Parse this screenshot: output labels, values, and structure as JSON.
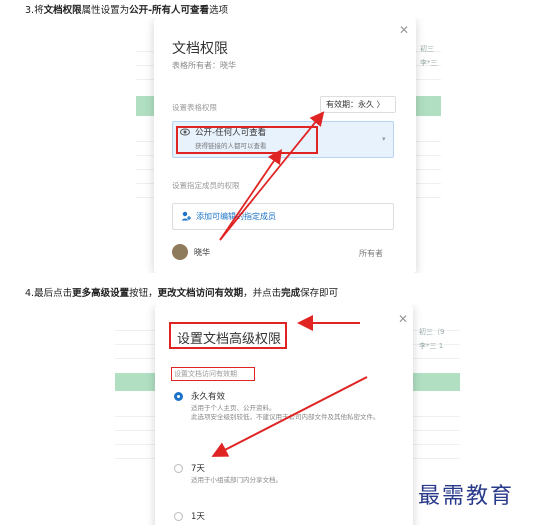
{
  "step3": {
    "prefix": "3.将",
    "bold1": "文档权限",
    "mid": "属性设置为",
    "bold2": "公开-所有人可查看",
    "suffix": "选项"
  },
  "dialog1": {
    "title": "文档权限",
    "owner_line": "表格所有者：晓华",
    "perm_label": "设置表格权限",
    "validity": "有效期：永久 〉",
    "option_main": "公开-任何人可查看",
    "option_sub": "获得链接的人都可以查看",
    "member_label": "设置指定成员的权限",
    "add_member": "添加可编辑的指定成员",
    "owner_name": "晓华",
    "owner_role": "所有者",
    "bg_cells": [
      "初三",
      "李*三"
    ]
  },
  "step4": {
    "prefix": "4.最后点击",
    "bold1": "更多高级设置",
    "mid1": "按钮，",
    "bold2": "更改文档访问有效期",
    "mid2": "，并点击",
    "bold3": "完成",
    "suffix": "保存即可"
  },
  "dialog2": {
    "title": "设置文档高级权限",
    "sub_label": "设置文档访问有效期",
    "options": [
      {
        "title": "永久有效",
        "desc": "适用于个人主页、公开资料。\n此选项安全级别较低，不建议用于公司内部文件及其他私密文件。",
        "selected": true
      },
      {
        "title": "7天",
        "desc": "适用于小组或部门内分享文档。",
        "selected": false
      },
      {
        "title": "1天",
        "desc": "",
        "selected": false
      }
    ],
    "bg_cells": [
      "初三（9",
      "李*三 1"
    ]
  },
  "watermark": "最需教育",
  "colors": {
    "accent": "#1a73c8",
    "highlight": "#e02424",
    "table_green": "#71c48f"
  }
}
